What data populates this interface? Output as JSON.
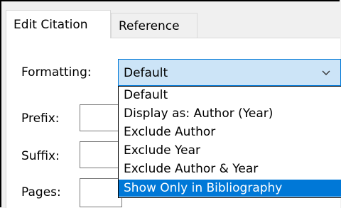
{
  "tabs": [
    {
      "label": "Edit Citation",
      "active": true
    },
    {
      "label": "Reference",
      "active": false
    }
  ],
  "form": {
    "formatting_label": "Formatting:",
    "formatting_value": "Default",
    "prefix_label": "Prefix:",
    "suffix_label": "Suffix:",
    "pages_label": "Pages:"
  },
  "dropdown": {
    "options": [
      "Default",
      "Display as: Author (Year)",
      "Exclude Author",
      "Exclude Year",
      "Exclude Author & Year",
      "Show Only in Bibliography"
    ],
    "highlighted": "Show Only in Bibliography"
  },
  "colors": {
    "accent": "#0078d7",
    "combo_bg": "#cce4f7",
    "panel_bg": "#ffffff",
    "window_bg": "#f0f0f0"
  },
  "icons": {
    "combo_arrow": "chevron-down-icon"
  }
}
